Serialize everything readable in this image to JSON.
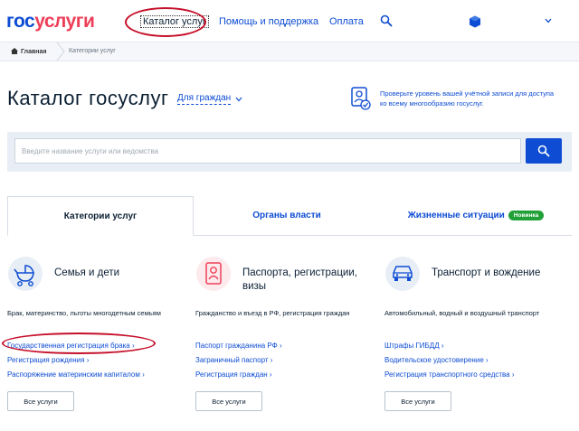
{
  "header": {
    "logo_gos": "гос",
    "logo_uslugi": "услуги",
    "nav": {
      "catalog": "Каталог услуг",
      "help": "Помощь и поддержка",
      "payment": "Оплата"
    },
    "icons": [
      "search-icon",
      "user-icon",
      "chevron-down-icon"
    ]
  },
  "breadcrumb": {
    "home": "Главная",
    "current": "Категории услуг"
  },
  "page": {
    "title": "Каталог госуслуг",
    "audience": "Для граждан",
    "verify_text": "Проверьте уровень вашей учётной записи для доступа ко всему многообразию госуслуг."
  },
  "search": {
    "placeholder": "Введите название услуги или ведомства"
  },
  "tabs": [
    {
      "label": "Категории услуг",
      "active": true
    },
    {
      "label": "Органы власти",
      "active": false
    },
    {
      "label": "Жизненные ситуации",
      "active": false,
      "badge": "Новинка"
    }
  ],
  "categories": [
    {
      "icon": "stroller-icon",
      "title": "Семья и дети",
      "description": "Брак, материнство, льготы многодетным семьям",
      "links": [
        "Государственная регистрация брака",
        "Регистрация рождения",
        "Распоряжение материнским капиталом"
      ],
      "all_label": "Все услуги"
    },
    {
      "icon": "passport-icon",
      "title": "Паспорта, регистрации, визы",
      "description": "Гражданство и въезд в РФ, регистрация граждан",
      "links": [
        "Паспорт гражданина РФ",
        "Заграничный паспорт",
        "Регистрация граждан"
      ],
      "all_label": "Все услуги"
    },
    {
      "icon": "car-icon",
      "title": "Транспорт и вождение",
      "description": "Автомобильный, водный и воздушный транспорт",
      "links": [
        "Штрафы ГИБДД",
        "Водительское удостоверение",
        "Регистрация транспортного средства"
      ],
      "all_label": "Все услуги"
    }
  ],
  "colors": {
    "brand_blue": "#0d4cd3",
    "brand_red": "#ee3f58",
    "annotation_red": "#c5102a",
    "badge_green": "#21a038"
  }
}
